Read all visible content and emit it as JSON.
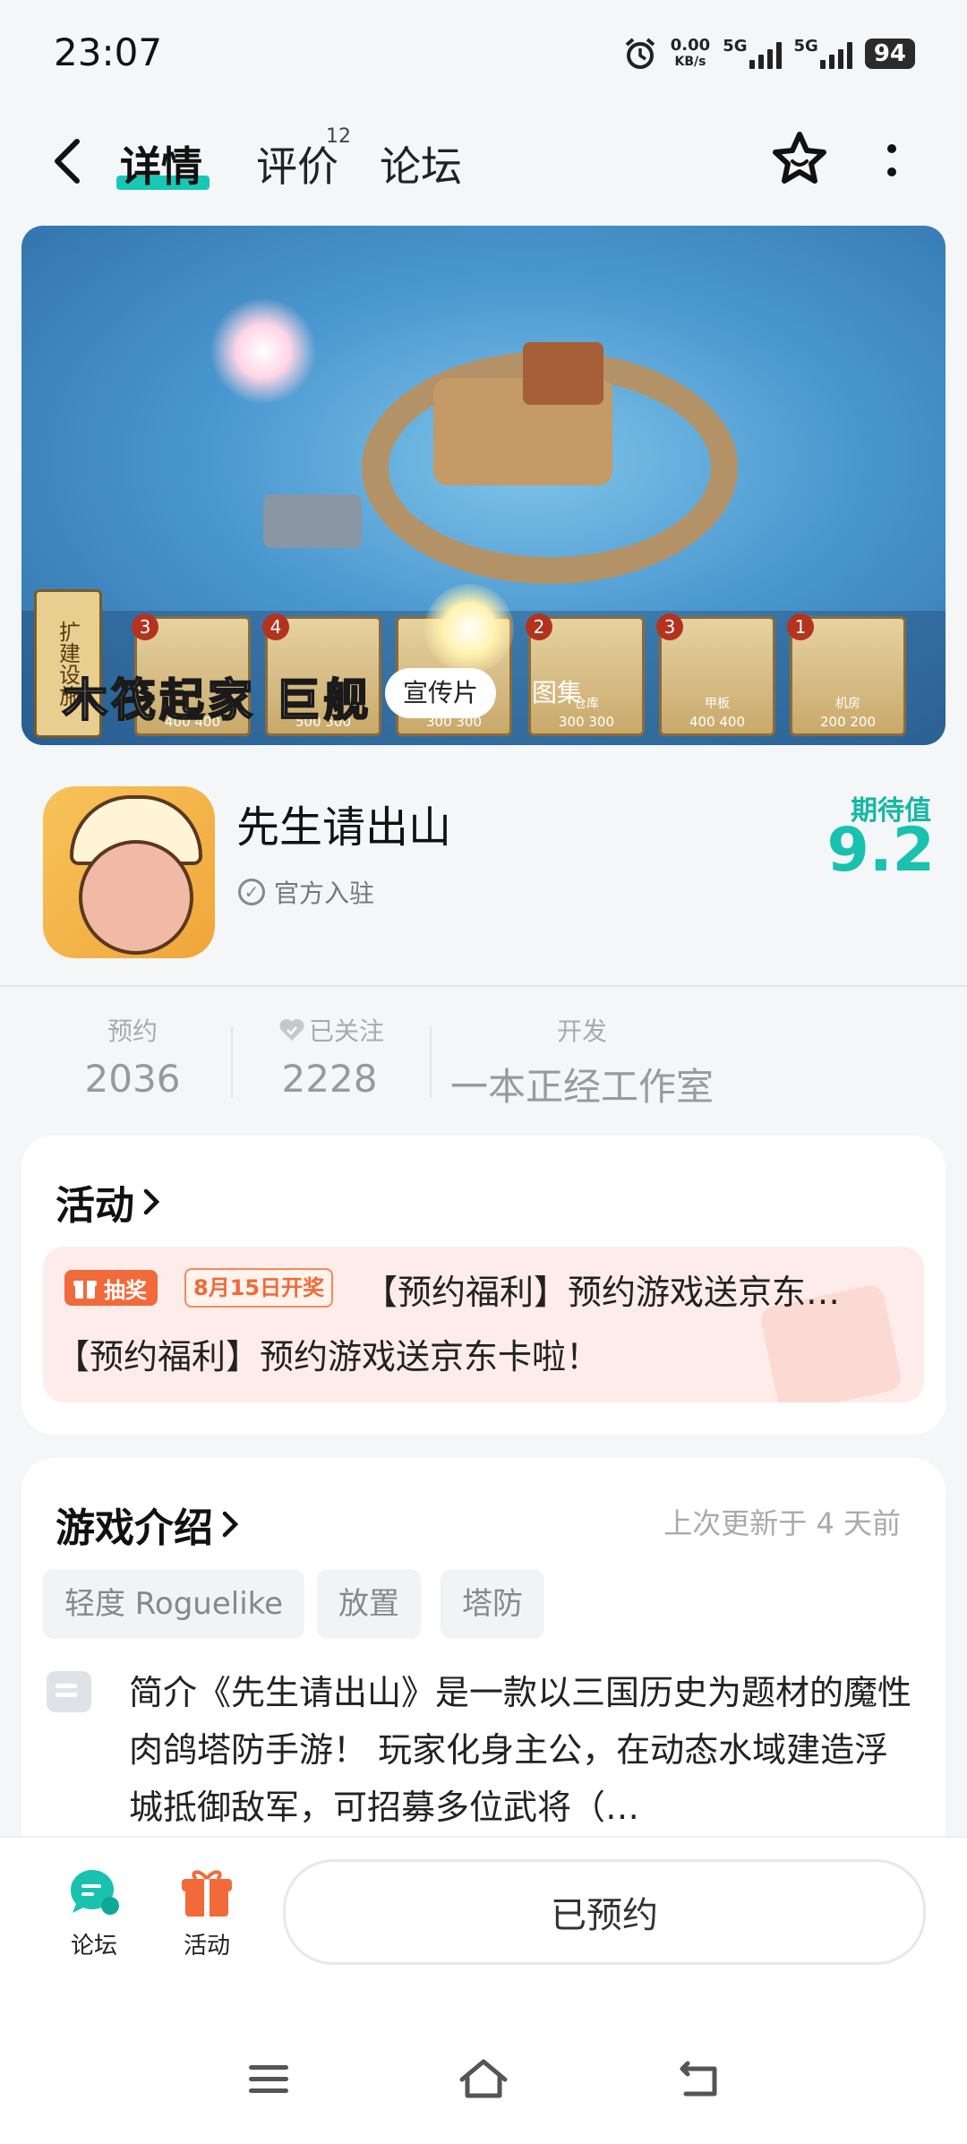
{
  "status_bar": {
    "time": "23:07",
    "network_speed": "0.00",
    "network_unit": "KB/s",
    "sim1": "5G",
    "sim2": "5G",
    "battery": "94"
  },
  "nav": {
    "tabs": [
      {
        "label": "详情",
        "active": true
      },
      {
        "label": "评价",
        "badge": "12"
      },
      {
        "label": "论坛"
      }
    ]
  },
  "banner": {
    "slogan": "木筏起家 巨舰",
    "side_label": "扩建设施",
    "media_tabs": [
      "宣传片",
      "图集"
    ],
    "cards": [
      {
        "level": "3",
        "label": "",
        "cost": "400   400"
      },
      {
        "level": "4",
        "label": "",
        "cost": "500   500"
      },
      {
        "level": "",
        "label": "",
        "cost": "300   300"
      },
      {
        "level": "2",
        "label": "仓库",
        "cost": "300   300"
      },
      {
        "level": "3",
        "label": "甲板",
        "cost": "400   400"
      },
      {
        "level": "1",
        "label": "机房",
        "cost": "200   200"
      }
    ]
  },
  "app": {
    "title": "先生请出山",
    "official": "官方入驻",
    "expect_label": "期待值",
    "expect_value": "9.2"
  },
  "stats": [
    {
      "label": "预约",
      "value": "2036"
    },
    {
      "label": "已关注",
      "value": "2228"
    },
    {
      "label": "开发",
      "value": "一本正经工作室"
    }
  ],
  "activity": {
    "title": "活动",
    "badge": "抽奖",
    "date": "8月15日开奖",
    "line1": "【预约福利】预约游戏送京东…",
    "line2": "【预约福利】预约游戏送京东卡啦！"
  },
  "intro": {
    "title": "游戏介绍",
    "updated": "上次更新于 4 天前",
    "tags": [
      "轻度 Roguelike",
      "放置",
      "塔防"
    ],
    "text": "简介《先生请出山》是一款以三国历史为题材的魔性肉鸽塔防手游！ 玩家化身主公，在动态水域建造浮城抵御敌军，可招募多位武将（…"
  },
  "bottom_bar": {
    "forum_label": "论坛",
    "activity_label": "活动",
    "reserve_label": "已预约"
  },
  "colors": {
    "accent": "#18c2ae",
    "promo_bg": "#fdecea",
    "badge_orange": "#f06a3b"
  }
}
